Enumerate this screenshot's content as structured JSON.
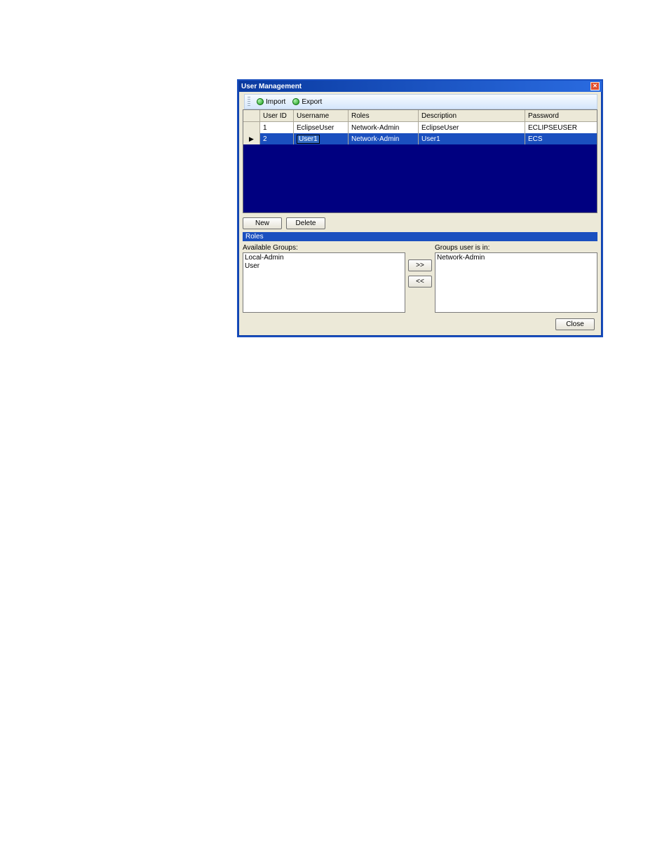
{
  "window": {
    "title": "User Management",
    "close_glyph": "✕"
  },
  "toolbar": {
    "import_label": "Import",
    "export_label": "Export"
  },
  "grid": {
    "headers": {
      "user_id": "User ID",
      "username": "Username",
      "roles": "Roles",
      "description": "Description",
      "password": "Password"
    },
    "rows": [
      {
        "indicator": "",
        "user_id": "1",
        "username": "EclipseUser",
        "roles": "Network-Admin",
        "description": "EclipseUser",
        "password": "ECLIPSEUSER",
        "selected": false,
        "editing_username": false
      },
      {
        "indicator": "▶",
        "user_id": "2",
        "username": "User1",
        "roles": "Network-Admin",
        "description": "User1",
        "password": "ECS",
        "selected": true,
        "editing_username": true
      }
    ]
  },
  "buttons": {
    "new": "New",
    "delete": "Delete",
    "add": ">>",
    "remove": "<<",
    "close": "Close"
  },
  "roles_section": {
    "header": "Roles",
    "available_label": "Available Groups:",
    "member_label": "Groups user is in:",
    "available": [
      "Local-Admin",
      "User"
    ],
    "member": [
      "Network-Admin"
    ]
  }
}
